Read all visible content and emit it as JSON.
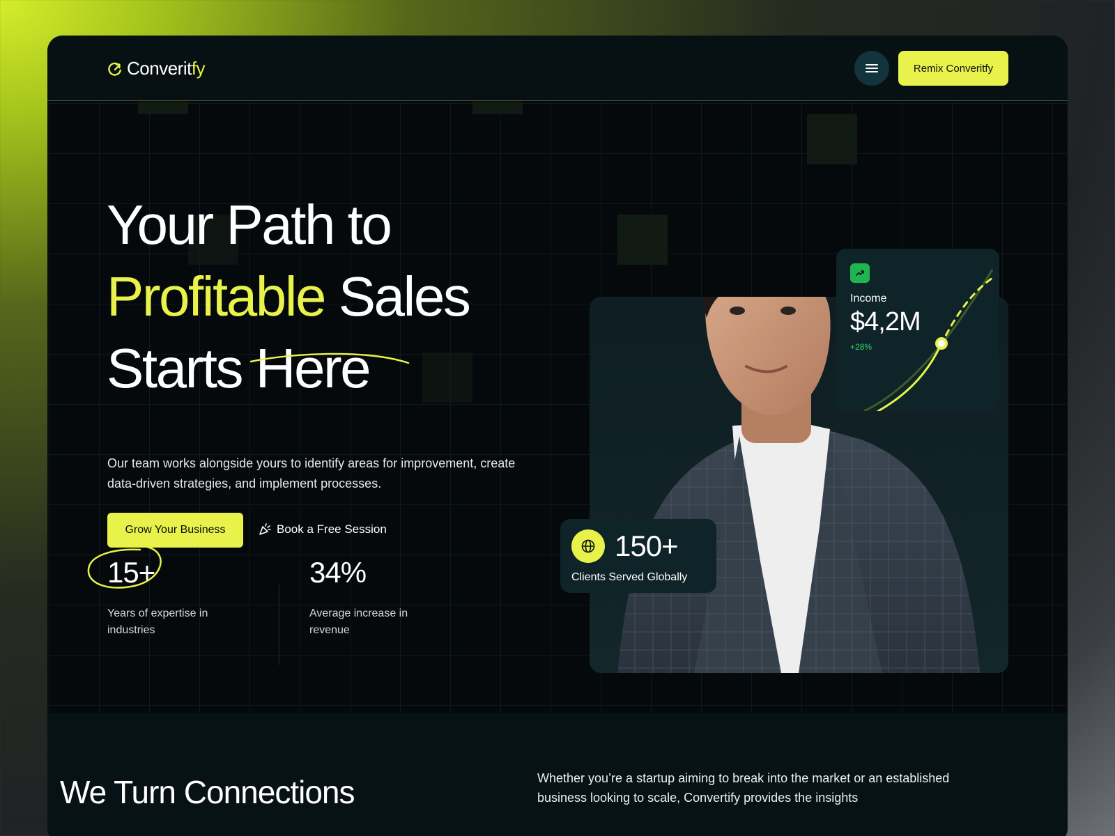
{
  "brand": {
    "name_main": "Converit",
    "name_accent": "fy",
    "accent_color": "#e8f24a"
  },
  "nav": {
    "menu_icon": "hamburger-icon",
    "remix_label": "Remix Converitfy"
  },
  "hero": {
    "title_line1": "Your Path to",
    "title_highlight": "Profitable",
    "title_line2_rest": " Sales",
    "title_line3": "Starts Here",
    "subtitle": "Our team works alongside yours to identify areas for improvement, create data-driven strategies, and implement processes.",
    "primary_cta": "Grow Your Business",
    "secondary_cta": "Book a Free Session",
    "secondary_icon": "party-popper-icon"
  },
  "stats": [
    {
      "value": "15+",
      "label": "Years of expertise in industries"
    },
    {
      "value": "34%",
      "label": "Average increase in revenue"
    }
  ],
  "income_card": {
    "icon": "trending-up-icon",
    "label": "Income",
    "value": "$4,2M",
    "change": "+28%",
    "positive_color": "#1fb553"
  },
  "clients_card": {
    "icon": "globe-icon",
    "value": "150+",
    "label": "Clients Served Globally"
  },
  "section2": {
    "title": "We Turn Connections",
    "text": "Whether you’re a startup aiming to break into the market or an established business looking to scale, Convertify provides the insights"
  }
}
